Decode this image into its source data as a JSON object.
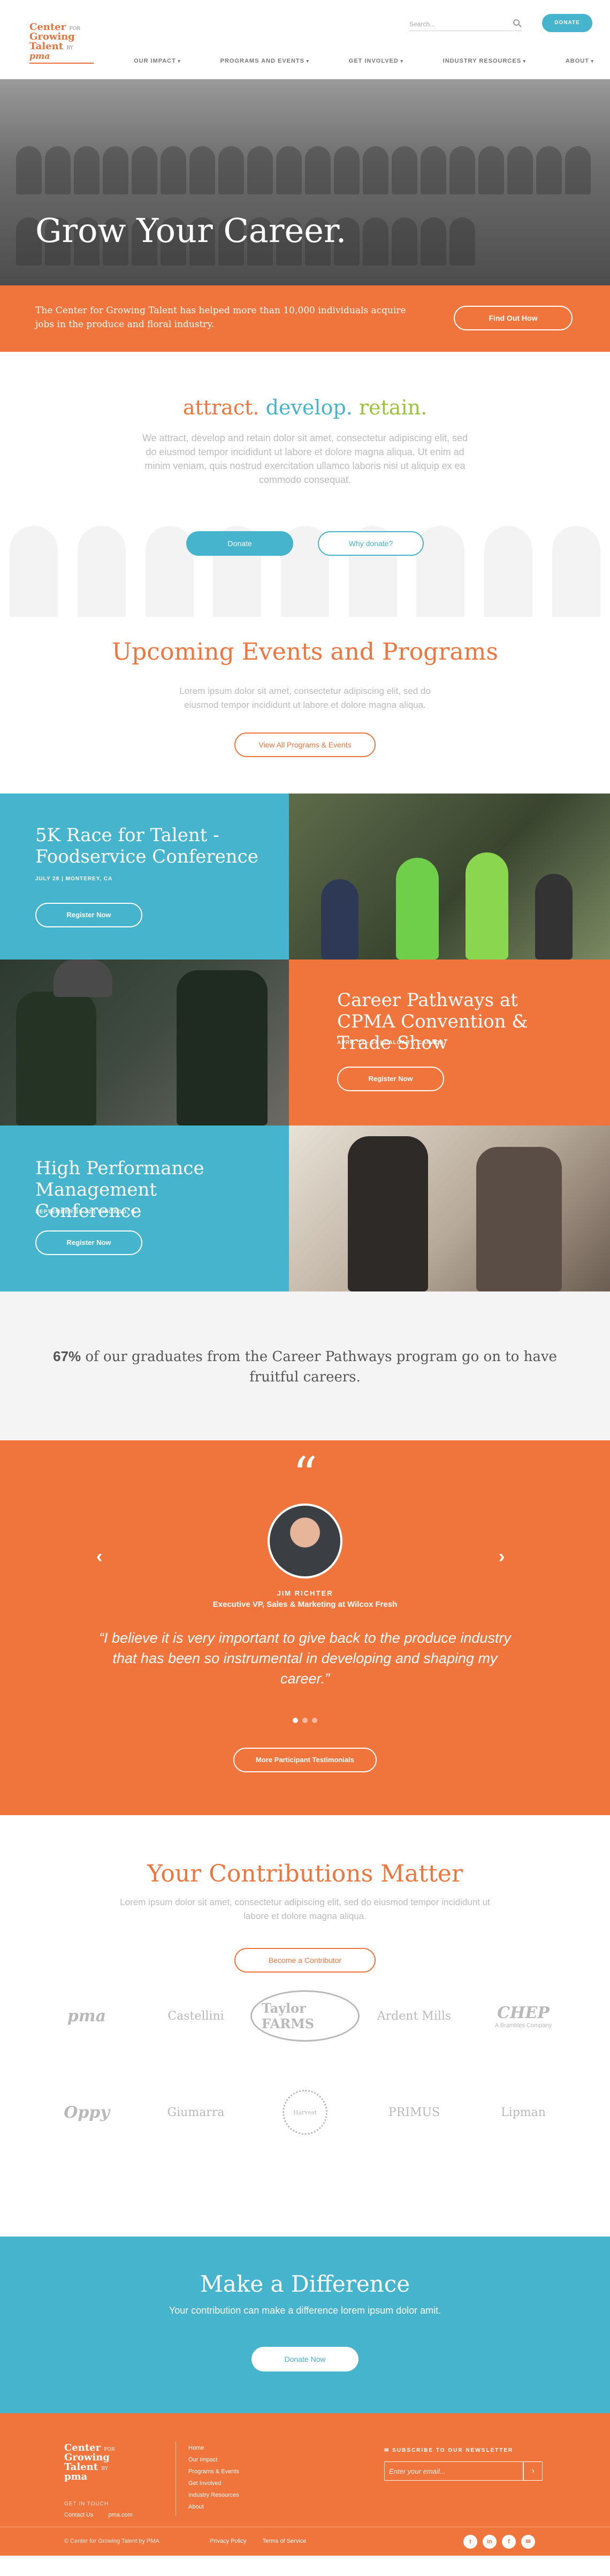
{
  "header": {
    "logo_line1": "Center",
    "logo_for": "FOR",
    "logo_line2": "Growing",
    "logo_line3": "Talent",
    "logo_by": "BY",
    "logo_pma": "pma",
    "search_placeholder": "Search...",
    "donate_label": "DONATE",
    "nav": [
      "OUR IMPACT",
      "PROGRAMS AND EVENTS",
      "GET INVOLVED",
      "INDUSTRY RESOURCES",
      "ABOUT"
    ]
  },
  "hero": {
    "title": "Grow Your Career.",
    "band_text": "The Center for Growing Talent has helped more than 10,000 individuals acquire jobs in the produce and floral industry.",
    "band_button": "Find Out How"
  },
  "intro": {
    "tag1": "attract.",
    "tag2": "develop.",
    "tag3": "retain.",
    "body": "We attract, develop and retain dolor sit amet, consectetur adipiscing elit, sed do eiusmod tempor incididunt ut labore et dolore magna aliqua. Ut enim ad minim veniam, quis nostrud exercitation ullamco laboris nisi ut aliquip ex ea commodo consequat.",
    "donate_button": "Donate",
    "why_button": "Why donate?"
  },
  "upcoming": {
    "title": "Upcoming Events and Programs",
    "body": "Lorem ipsum dolor sit amet, consectetur adipiscing elit, sed do eiusmod tempor incididunt ut labore et dolore magna aliqua.",
    "button": "View All Programs & Events"
  },
  "events": [
    {
      "title": "5K Race for Talent - Foodservice Conference",
      "meta": "JULY 28  |  MONTEREY, CA",
      "button": "Register Now"
    },
    {
      "title": "Career Pathways at CPMA Convention & Trade Show",
      "meta": "APRIL 12 - 14  |  CALGARY, CANADA",
      "button": "Register Now"
    },
    {
      "title": "High Performance Management Conference",
      "meta": "SEPTEMBER 19-22  |  CHICAGO, IL",
      "button": "Register Now"
    }
  ],
  "stat": {
    "value": "67%",
    "text": " of our graduates from the Career Pathways program go on to have fruitful careers."
  },
  "testimonial": {
    "quote_mark": "“",
    "name": "JIM RICHTER",
    "role": "Executive VP, Sales & Marketing at Wilcox Fresh",
    "quote": "“I believe it is very important to give back to the produce industry that has been so instrumental in developing and shaping my career.”",
    "prev": "‹",
    "next": "›",
    "dots_active": 0,
    "button": "More Participant Testimonials"
  },
  "contributions": {
    "title": "Your Contributions Matter",
    "body": "Lorem ipsum dolor sit amet, consectetur adipiscing elit, sed do eiusmod tempor incididunt ut labore et dolore magna aliqua.",
    "button": "Become a Contributor",
    "logos": [
      "pma",
      "Castellini",
      "Taylor FARMS",
      "Ardent Mills",
      "CHEP",
      "A Brambles Company",
      "Oppy",
      "Giumarra",
      "Harvest",
      "PRIMUS",
      "Lipman"
    ]
  },
  "make_difference": {
    "title": "Make a Difference",
    "body": "Your contribution can make a difference lorem ipsum dolor amit.",
    "button": "Donate Now"
  },
  "footer": {
    "get_in_touch": "GET IN TOUCH",
    "contact": "Contact Us",
    "site": "pma.com",
    "links": [
      "Home",
      "Our Impact",
      "Programs & Events",
      "Get Involved",
      "Industry Resources",
      "About"
    ],
    "newsletter_title": "SUBSCRIBE TO OUR NEWSLETTER",
    "newsletter_placeholder": "Enter your email...",
    "newsletter_go": "›",
    "copyright": "© Center for Growing Talent by PMA",
    "privacy": "Privacy Policy",
    "terms": "Terms of Service",
    "social": [
      "t",
      "in",
      "f",
      "✉"
    ]
  },
  "colors": {
    "orange": "#f0753c",
    "blue": "#45b4cc",
    "green": "#9cc43a"
  }
}
